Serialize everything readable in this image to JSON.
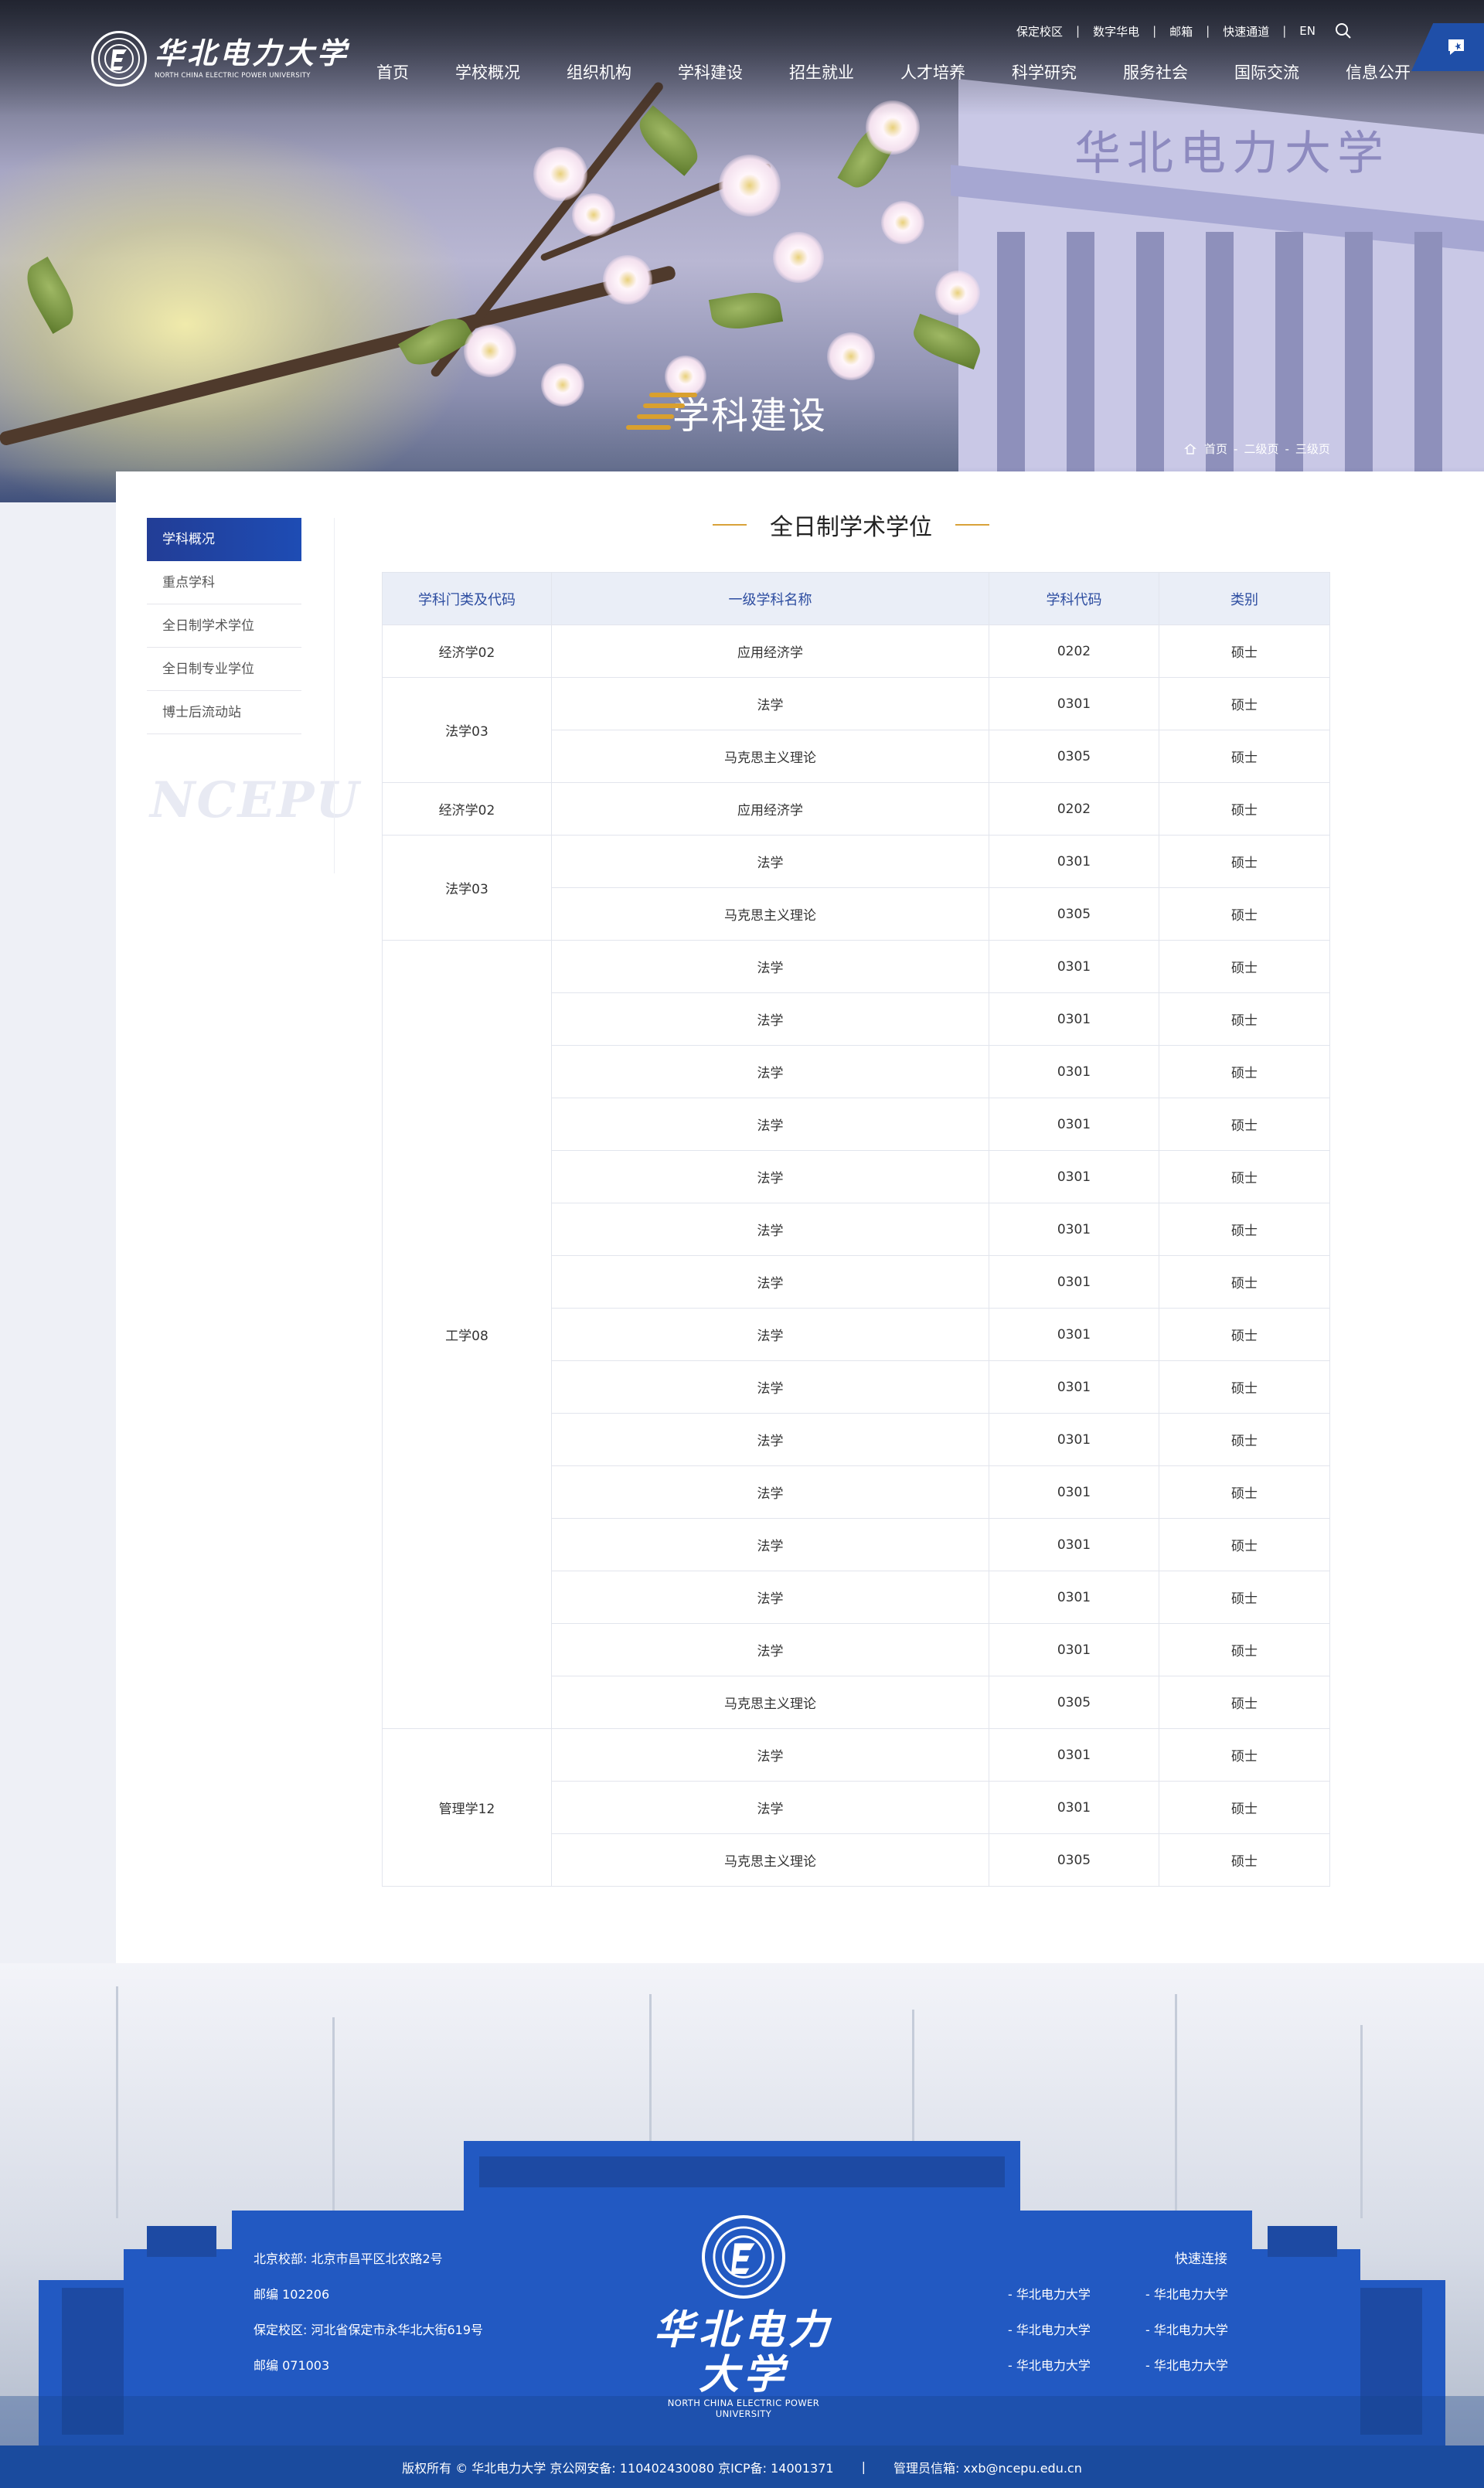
{
  "header": {
    "logo": {
      "cn": "华北电力大学",
      "en": "NORTH CHINA ELECTRIC POWER UNIVERSITY"
    },
    "top_links": [
      "保定校区",
      "数字华电",
      "邮箱",
      "快速通道",
      "EN"
    ],
    "search_icon": "search-icon",
    "side_tag_icon": "message-icon",
    "nav": [
      "首页",
      "学校概况",
      "组织机构",
      "学科建设",
      "招生就业",
      "人才培养",
      "科学研究",
      "服务社会",
      "国际交流",
      "信息公开"
    ],
    "nav_active": "学科建设"
  },
  "banner": {
    "title": "学科建设",
    "building_text": "华北电力大学",
    "breadcrumb": [
      "首页",
      "二级页",
      "三级页"
    ]
  },
  "sidebar": {
    "items": [
      "学科概况",
      "重点学科",
      "全日制学术学位",
      "全日制专业学位",
      "博士后流动站"
    ],
    "active": "学科概况",
    "watermark": "NCEPU"
  },
  "main": {
    "title": "全日制学术学位",
    "table": {
      "headers": [
        "学科门类及代码",
        "一级学科名称",
        "学科代码",
        "类别"
      ],
      "groups": [
        {
          "category": "经济学02",
          "rows": [
            [
              "应用经济学",
              "0202",
              "硕士"
            ]
          ]
        },
        {
          "category": "法学03",
          "rows": [
            [
              "法学",
              "0301",
              "硕士"
            ],
            [
              "马克思主义理论",
              "0305",
              "硕士"
            ]
          ]
        },
        {
          "category": "经济学02",
          "rows": [
            [
              "应用经济学",
              "0202",
              "硕士"
            ]
          ]
        },
        {
          "category": "法学03",
          "rows": [
            [
              "法学",
              "0301",
              "硕士"
            ],
            [
              "马克思主义理论",
              "0305",
              "硕士"
            ]
          ]
        },
        {
          "category": "工学08",
          "rows": [
            [
              "法学",
              "0301",
              "硕士"
            ],
            [
              "法学",
              "0301",
              "硕士"
            ],
            [
              "法学",
              "0301",
              "硕士"
            ],
            [
              "法学",
              "0301",
              "硕士"
            ],
            [
              "法学",
              "0301",
              "硕士"
            ],
            [
              "法学",
              "0301",
              "硕士"
            ],
            [
              "法学",
              "0301",
              "硕士"
            ],
            [
              "法学",
              "0301",
              "硕士"
            ],
            [
              "法学",
              "0301",
              "硕士"
            ],
            [
              "法学",
              "0301",
              "硕士"
            ],
            [
              "法学",
              "0301",
              "硕士"
            ],
            [
              "法学",
              "0301",
              "硕士"
            ],
            [
              "法学",
              "0301",
              "硕士"
            ],
            [
              "法学",
              "0301",
              "硕士"
            ],
            [
              "马克思主义理论",
              "0305",
              "硕士"
            ]
          ]
        },
        {
          "category": "管理学12",
          "rows": [
            [
              "法学",
              "0301",
              "硕士"
            ],
            [
              "法学",
              "0301",
              "硕士"
            ],
            [
              "马克思主义理论",
              "0305",
              "硕士"
            ]
          ]
        }
      ]
    }
  },
  "footer": {
    "info": [
      "北京校部: 北京市昌平区北农路2号",
      "邮编 102206",
      "保定校区: 河北省保定市永华北大街619号",
      "邮编 071003"
    ],
    "logo": {
      "cn": "华北电力大学",
      "en": "NORTH CHINA ELECTRIC POWER UNIVERSITY"
    },
    "quick_title": "快速连接",
    "quick_links_left": [
      "- 华北电力大学",
      "- 华北电力大学",
      "- 华北电力大学"
    ],
    "quick_links_right": [
      "- 华北电力大学",
      "- 华北电力大学",
      "- 华北电力大学"
    ],
    "copyright": "版权所有 © 华北电力大学  京公网安备: 110402430080  京ICP备: 14001371",
    "admin_email": "管理员信箱: xxb@ncepu.edu.cn"
  },
  "colors": {
    "primary": "#1e4cb4",
    "accent_gold": "#d9a23a",
    "table_header_bg": "#eaeef7",
    "footer_blue": "#2259c2"
  }
}
